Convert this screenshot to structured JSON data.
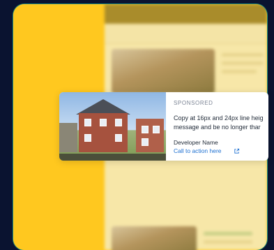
{
  "ad": {
    "label": "SPONSORED",
    "copy_line1": "Copy at 16px and 24px line heig",
    "copy_line2": "message and be no longer thar",
    "developer": "Developer Name",
    "cta": "Call to action here",
    "cta_icon": "external-link-icon"
  },
  "colors": {
    "background": "#0a1330",
    "accent_yellow": "#ffc81f",
    "link_blue": "#1c6fd1"
  }
}
